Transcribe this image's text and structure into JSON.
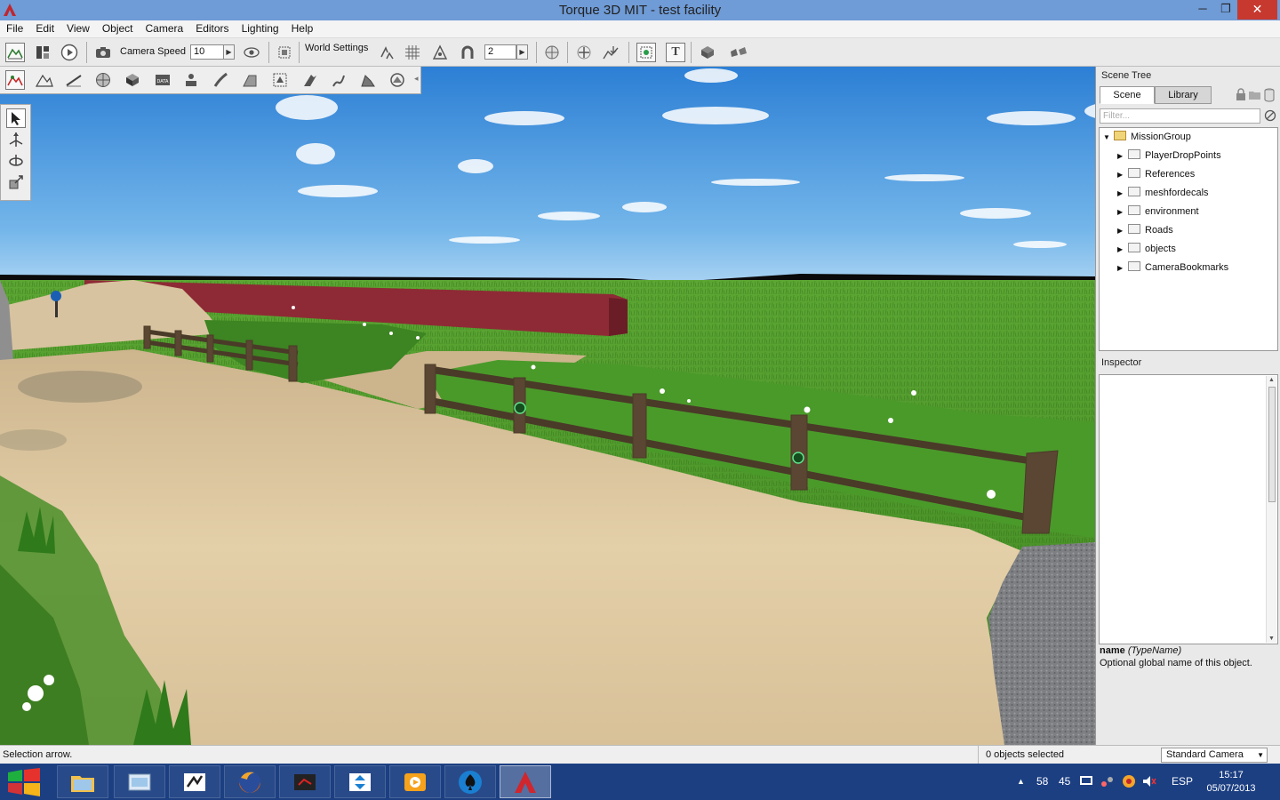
{
  "window": {
    "title": "Torque 3D MIT - test facility",
    "min": "─",
    "max": "❐",
    "close": "✕"
  },
  "menu": [
    "File",
    "Edit",
    "View",
    "Object",
    "Camera",
    "Editors",
    "Lighting",
    "Help"
  ],
  "toolbar": {
    "camera_speed_label": "Camera Speed",
    "camera_speed_value": "10",
    "world_settings_label": "World Settings",
    "snap_value": "2"
  },
  "scene_tree": {
    "title": "Scene Tree",
    "tabs": [
      "Scene",
      "Library"
    ],
    "filter_placeholder": "Filter...",
    "root": "MissionGroup",
    "children": [
      "PlayerDropPoints",
      "References",
      "meshfordecals",
      "environment",
      "Roads",
      "objects",
      "CameraBookmarks"
    ]
  },
  "inspector": {
    "title": "Inspector",
    "field_name": "name",
    "field_type": "(TypeName)",
    "description": "Optional global name of this object."
  },
  "status": {
    "left": "Selection arrow.",
    "selected": "0 objects selected",
    "camera": "Standard Camera"
  },
  "taskbar": {
    "tray_a": "58",
    "tray_b": "45",
    "lang": "ESP",
    "time": "15:17",
    "date": "05/07/2013"
  },
  "colors": {
    "titlebar": "#6f9bd6",
    "taskbar": "#1c3f82",
    "sky": "#3f8fd9",
    "grass": "#4f9a2a",
    "sand": "#d9c29a",
    "wall": "#8e2a35"
  }
}
